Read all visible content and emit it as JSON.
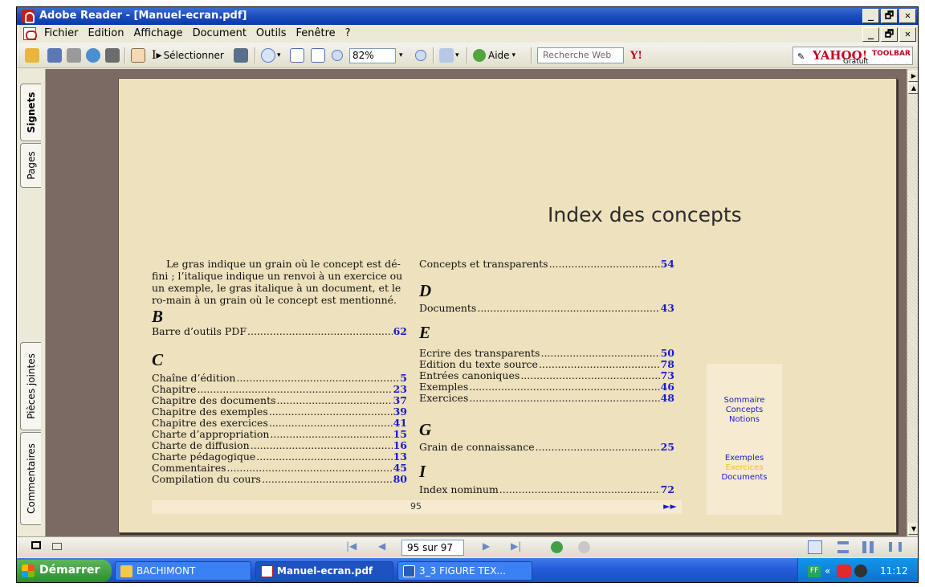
{
  "window": {
    "title": "Adobe Reader - [Manuel-ecran.pdf]",
    "buttons": [
      "_",
      "🗗",
      "✕"
    ]
  },
  "menubar": {
    "items": [
      "Fichier",
      "Edition",
      "Affichage",
      "Document",
      "Outils",
      "Fenêtre",
      "?"
    ]
  },
  "toolbar": {
    "select_label": "Sélectionner",
    "zoom_value": "82%",
    "help_label": "Aide",
    "search_placeholder": "Recherche Web",
    "yahoo_logo": "YAHOO!",
    "yahoo_toolbar": "TOOLBAR",
    "yahoo_gratuit": "Gratuit"
  },
  "sidetabs": [
    "Signets",
    "Pages",
    "Pièces jointes",
    "Commentaires"
  ],
  "document": {
    "heading": "Index des concepts",
    "intro": "Le gras indique un grain où le concept est dé-fini ; l’italique indique un renvoi à un exercice ou un exemple, le gras italique à un document, et le ro-main à un grain où le concept est mentionné.",
    "letters": {
      "B": "B",
      "C": "C",
      "D": "D",
      "E": "E",
      "G": "G",
      "I": "I"
    },
    "entries": {
      "b1": {
        "label": "Barre d’outils PDF",
        "num": "62"
      },
      "c1": {
        "label": "Chaîne d’édition",
        "num": "5"
      },
      "c2": {
        "label": "Chapitre",
        "num": "23"
      },
      "c3": {
        "label": "Chapitre des documents",
        "num": "37"
      },
      "c4": {
        "label": "Chapitre des exemples",
        "num": "39"
      },
      "c5": {
        "label": "Chapitre des exercices",
        "num": "41"
      },
      "c6": {
        "label": "Charte d’appropriation",
        "num": "15"
      },
      "c7": {
        "label": "Charte de diffusion",
        "num": "16"
      },
      "c8": {
        "label": "Charte pédagogique",
        "num": "13"
      },
      "c9": {
        "label": "Commentaires",
        "num": "45"
      },
      "c10": {
        "label": "Compilation du cours",
        "num": "80"
      },
      "c11": {
        "label": "Concepts et transparents",
        "num": "54"
      },
      "d1": {
        "label": "Documents",
        "num": "43"
      },
      "e1": {
        "label": "Ecrire des transparents",
        "num": "50"
      },
      "e2": {
        "label": "Edition du texte source",
        "num": "78"
      },
      "e3": {
        "label": "Entrées canoniques",
        "num": "73"
      },
      "e4": {
        "label": "Exemples",
        "num": "46"
      },
      "e5": {
        "label": "Exercices",
        "num": "48"
      },
      "g1": {
        "label": "Grain de connaissance",
        "num": "25"
      },
      "i1": {
        "label": "Index nominum",
        "num": "72"
      }
    },
    "page_number": "95",
    "next_arrows": "►►",
    "sidepanel": {
      "sommaire": "Sommaire",
      "concepts": "Concepts",
      "notions": "Notions",
      "exemples": "Exemples",
      "exercices": "Exercices",
      "documents": "Documents"
    }
  },
  "statusbar": {
    "page_indicator": "95 sur 97"
  },
  "taskbar": {
    "start": "Démarrer",
    "tasks": [
      "BACHIMONT",
      "Manuel-ecran.pdf",
      "3_3 FIGURE TEX..."
    ],
    "tray_chevron": "«",
    "tray_ff": "FF",
    "clock": "11:12"
  },
  "colors": {
    "link_blue": "#1a1acb",
    "page_bg": "#eee1bd",
    "workspace_bg": "#7a6a63",
    "yellow_link": "#f0c020"
  }
}
